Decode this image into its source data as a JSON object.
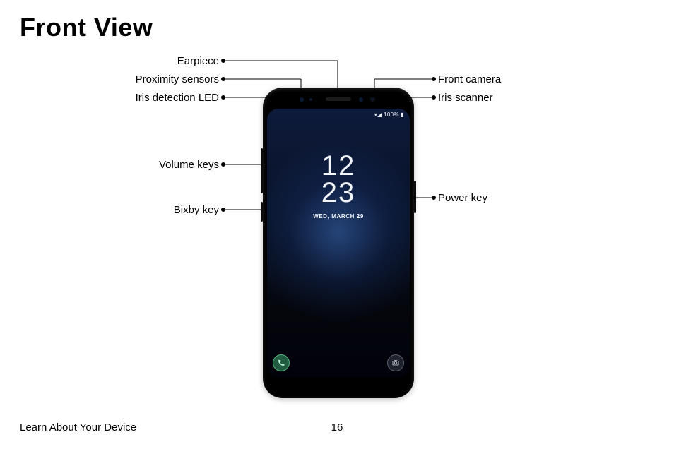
{
  "title": "Front View",
  "footer": {
    "section": "Learn About Your Device",
    "page": "16"
  },
  "phone_screen": {
    "status": "100%",
    "clock_hh": "12",
    "clock_mm": "23",
    "date": "WED, MARCH 29"
  },
  "callouts": {
    "earpiece": "Earpiece",
    "proximity": "Proximity sensors",
    "iris_led": "Iris detection LED",
    "front_camera": "Front camera",
    "iris_scanner": "Iris scanner",
    "volume_keys": "Volume keys",
    "bixby_key": "Bixby key",
    "power_key": "Power key"
  }
}
